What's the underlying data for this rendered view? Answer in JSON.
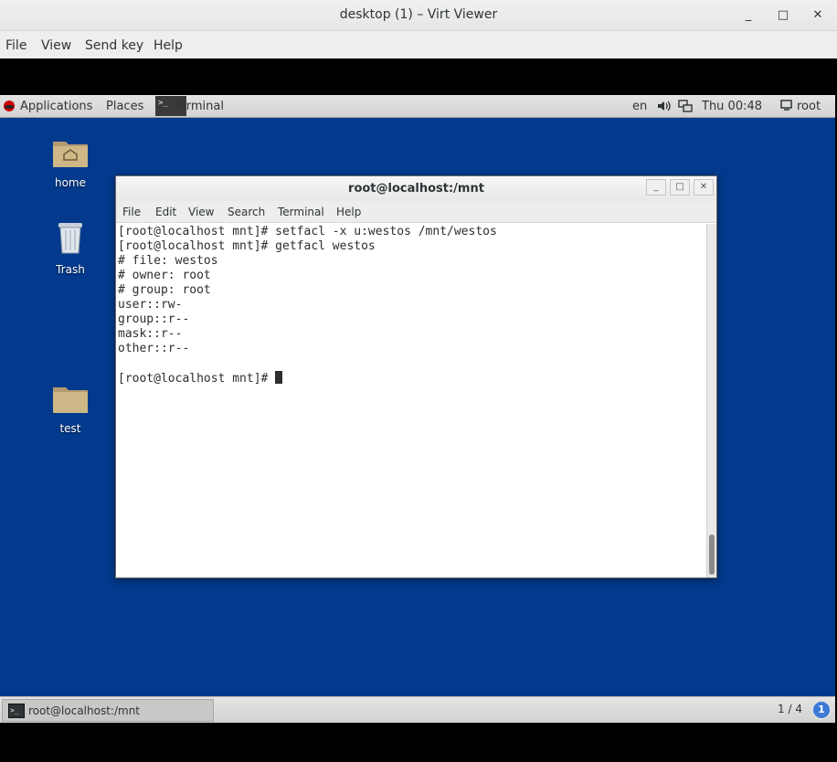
{
  "viewer": {
    "title": "desktop (1) – Virt Viewer",
    "menu": [
      "File",
      "View",
      "Send key",
      "Help"
    ],
    "controls": {
      "minimize": "_",
      "maximize": "□",
      "close": "✕"
    }
  },
  "panel": {
    "applications": "Applications",
    "places": "Places",
    "terminal": "Terminal",
    "lang": "en",
    "clock": "Thu 00:48",
    "user": "root"
  },
  "desktop_icons": [
    {
      "label": "home"
    },
    {
      "label": "Trash"
    },
    {
      "label": "test"
    }
  ],
  "terminal": {
    "title": "root@localhost:/mnt",
    "menu": [
      "File",
      "Edit",
      "View",
      "Search",
      "Terminal",
      "Help"
    ],
    "lines": [
      "[root@localhost mnt]# setfacl -x u:westos /mnt/westos",
      "[root@localhost mnt]# getfacl westos",
      "# file: westos",
      "# owner: root",
      "# group: root",
      "user::rw-",
      "group::r--",
      "mask::r--",
      "other::r--",
      "",
      "[root@localhost mnt]# "
    ]
  },
  "taskbar": {
    "task_label": "root@localhost:/mnt",
    "workspace": "1 / 4",
    "badge": "1"
  }
}
